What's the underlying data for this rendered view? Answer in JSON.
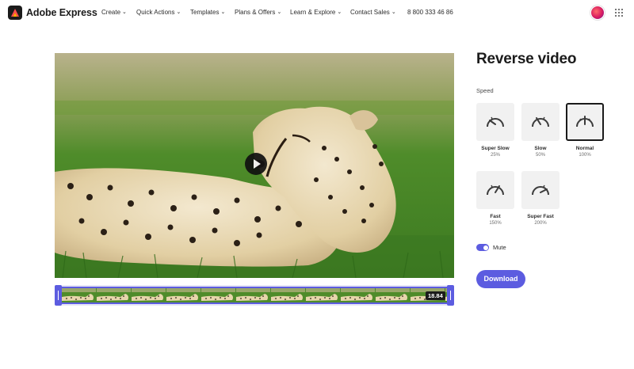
{
  "header": {
    "brand": "Adobe Express",
    "nav": [
      {
        "label": "Create"
      },
      {
        "label": "Quick Actions"
      },
      {
        "label": "Templates"
      },
      {
        "label": "Plans & Offers"
      },
      {
        "label": "Learn & Explore"
      },
      {
        "label": "Contact Sales"
      }
    ],
    "phone": "8 800 333 46 86",
    "icons": {
      "logo": "adobe-express-logo",
      "apps": "app-grid-icon",
      "avatar": "user-avatar"
    }
  },
  "editor": {
    "title": "Reverse video",
    "speed_label": "Speed",
    "speeds": [
      {
        "name": "Super Slow",
        "pct": "25%",
        "selected": false,
        "icon": "speedometer-super-slow-icon"
      },
      {
        "name": "Slow",
        "pct": "50%",
        "selected": false,
        "icon": "speedometer-slow-icon"
      },
      {
        "name": "Normal",
        "pct": "100%",
        "selected": true,
        "icon": "speedometer-normal-icon"
      },
      {
        "name": "Fast",
        "pct": "150%",
        "selected": false,
        "icon": "speedometer-fast-icon"
      },
      {
        "name": "Super Fast",
        "pct": "200%",
        "selected": false,
        "icon": "speedometer-super-fast-icon"
      }
    ],
    "mute_label": "Mute",
    "mute_on": true,
    "download_label": "Download"
  },
  "video": {
    "duration": "18.84",
    "icons": {
      "play": "play-icon"
    }
  },
  "colors": {
    "accent": "#5c5ce0",
    "text": "#1b1b1b",
    "tile": "#f1f1f1"
  }
}
